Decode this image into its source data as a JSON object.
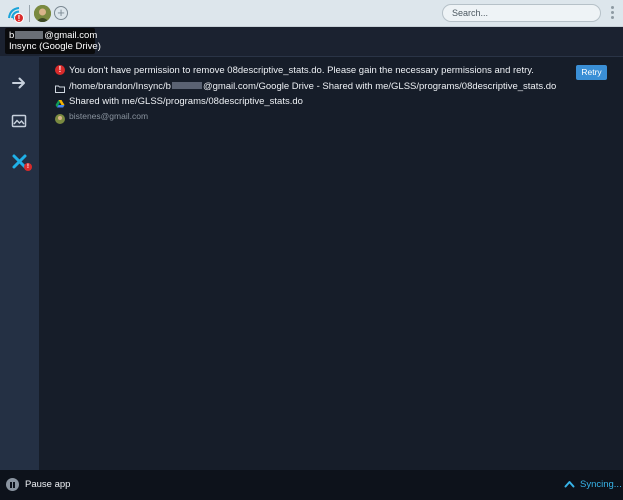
{
  "topbar": {
    "badge": "!",
    "add_label": "+",
    "search_placeholder": "Search...",
    "icons": [
      "insync-logo-icon",
      "error-badge-icon",
      "account-avatar-icon",
      "add-account-icon",
      "kebab-menu-icon"
    ]
  },
  "tooltip": {
    "email_prefix": "b",
    "email_suffix": "@gmail.com",
    "account_label": "Insync (Google Drive)"
  },
  "sidebar": {
    "items": [
      {
        "name": "sync-activity",
        "icon": "arrow-right-icon"
      },
      {
        "name": "recent-changes",
        "icon": "image-icon"
      },
      {
        "name": "errors",
        "icon": "close-x-icon",
        "badge": "!"
      }
    ],
    "colors": {
      "icon": "#c7d0dc",
      "error": "#1fb0e8",
      "badge": "#d92b2b"
    }
  },
  "error_item": {
    "message": "You don't have permission to remove 08descriptive_stats.do. Please gain the necessary permissions and retry.",
    "local_path_prefix": "/home/brandon/Insync/b",
    "local_path_suffix": "@gmail.com/Google Drive - Shared with me/GLSS/programs/08descriptive_stats.do",
    "cloud_path": "Shared with me/GLSS/programs/08descriptive_stats.do",
    "owner": "bistenes@gmail.com",
    "retry_label": "Retry",
    "icons": [
      "error-icon",
      "folder-icon",
      "google-drive-icon",
      "owner-avatar-icon"
    ]
  },
  "footer": {
    "pause_label": "Pause app",
    "sync_label": "Syncing...",
    "accent": "#37b3e8"
  }
}
